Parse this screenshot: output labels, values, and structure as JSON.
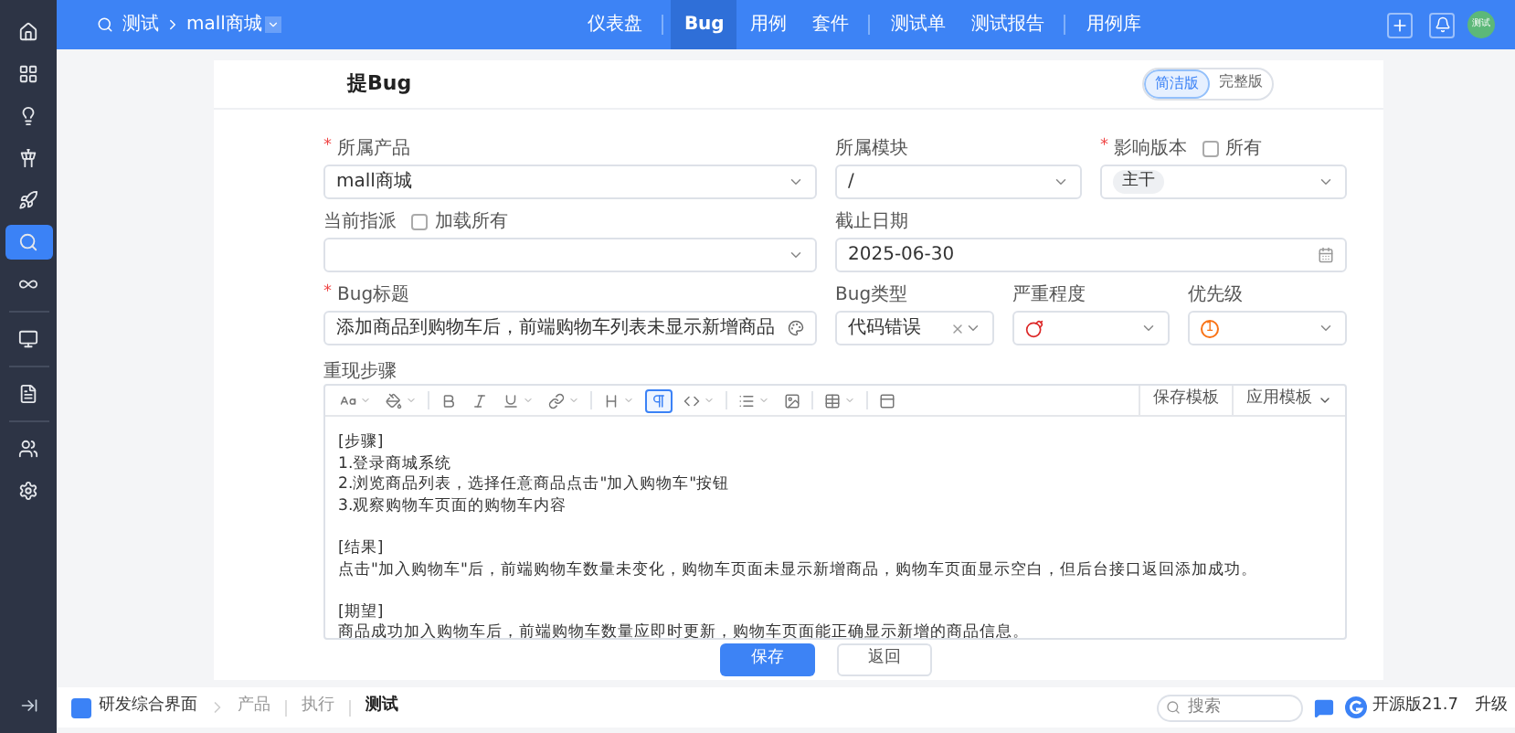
{
  "sidebar": {
    "groups": [
      [
        {
          "kind": "home",
          "selected": false
        },
        {
          "kind": "grid",
          "selected": false
        },
        {
          "kind": "bulb",
          "selected": false
        },
        {
          "kind": "tower",
          "selected": false
        },
        {
          "kind": "rocket",
          "selected": false
        },
        {
          "kind": "search",
          "selected": true
        },
        {
          "kind": "loop",
          "selected": false
        }
      ],
      [
        {
          "kind": "monitor",
          "selected": false
        }
      ],
      [
        {
          "kind": "file",
          "selected": false
        }
      ],
      [
        {
          "kind": "users",
          "selected": false
        },
        {
          "kind": "settings",
          "selected": false
        }
      ]
    ]
  },
  "topbar": {
    "project": "测试",
    "product": "mall商城",
    "nav": [
      [
        {
          "label": "仪表盘",
          "selected": false
        }
      ],
      [
        {
          "label": "Bug",
          "selected": true
        },
        {
          "label": "用例",
          "selected": false
        },
        {
          "label": "套件",
          "selected": false
        }
      ],
      [
        {
          "label": "测试单",
          "selected": false
        },
        {
          "label": "测试报告",
          "selected": false
        }
      ],
      [
        {
          "label": "用例库",
          "selected": false
        }
      ]
    ],
    "avatar": "测试"
  },
  "form": {
    "title": "提Bug",
    "modes": [
      {
        "label": "简洁版",
        "selected": true
      },
      {
        "label": "完整版",
        "selected": false
      }
    ],
    "product": {
      "marker": "*",
      "label": "所属产品",
      "value": "mall商城"
    },
    "module": {
      "label": "所属模块",
      "value": "/"
    },
    "version": {
      "marker": "*",
      "label": "影响版本",
      "checkbox": "所有",
      "checked": false,
      "tag": "主干"
    },
    "assignee": {
      "label": "当前指派",
      "checkbox": "加载所有",
      "checked": false
    },
    "deadline": {
      "label": "截止日期",
      "value": "2025-06-30"
    },
    "bug_title": {
      "marker": "*",
      "label": "Bug标题",
      "value": "添加商品到购物车后，前端购物车列表未显示新增商品"
    },
    "bug_type": {
      "label": "Bug类型",
      "value": "代码错误"
    },
    "severity": {
      "label": "严重程度"
    },
    "priority": {
      "label": "优先级",
      "value": "1"
    },
    "steps": {
      "label": "重现步骤",
      "toolbar": [
        {
          "kind": "font",
          "selected": false
        },
        {
          "kind": "color",
          "selected": false
        },
        {
          "kind": "bold",
          "selected": false
        },
        {
          "kind": "italic",
          "selected": false
        },
        {
          "kind": "underline",
          "selected": false
        },
        {
          "kind": "link",
          "selected": false
        },
        {
          "kind": "heading",
          "selected": false
        },
        {
          "kind": "paragraph",
          "selected": true
        },
        {
          "kind": "code",
          "selected": false
        },
        {
          "kind": "list",
          "selected": false
        },
        {
          "kind": "image",
          "selected": false
        },
        {
          "kind": "table",
          "selected": false
        },
        {
          "kind": "block",
          "selected": false
        }
      ],
      "save_template": "保存模板",
      "apply_template": "应用模板",
      "paragraphs": [
        [
          "[步骤]",
          "1.登录商城系统",
          "2.浏览商品列表，选择任意商品点击\"加入购物车\"按钮",
          "3.观察购物车页面的购物车内容"
        ],
        [
          "[结果]",
          "点击\"加入购物车\"后，前端购物车数量未变化，购物车页面未显示新增商品，购物车页面显示空白，但后台接口返回添加成功。"
        ],
        [
          "[期望]",
          "商品成功加入购物车后，前端购物车数量应即时更新，购物车页面能正确显示新增的商品信息。"
        ]
      ]
    },
    "buttons": [
      {
        "kind": "primary",
        "label": "保存"
      },
      {
        "kind": "secondary",
        "label": "返回"
      }
    ]
  },
  "bottombar": {
    "app": "研发综合界面",
    "crumbs": [
      {
        "label": "产品",
        "selected": false
      },
      {
        "label": "执行",
        "selected": false
      },
      {
        "label": "测试",
        "selected": true
      }
    ],
    "search": {
      "placeholder": "搜索"
    },
    "edition": "开源版21.7",
    "upgrade": "升级"
  }
}
